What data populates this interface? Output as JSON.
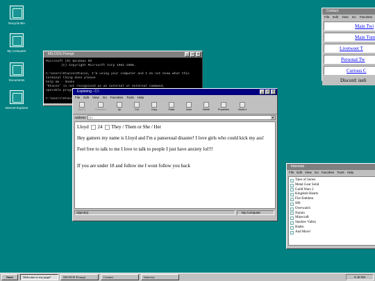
{
  "desktop": {
    "icons": [
      {
        "label": "Recycle Bin"
      },
      {
        "label": "My Computer"
      },
      {
        "label": "Documents"
      },
      {
        "label": "Internet Explorer"
      }
    ]
  },
  "dos_window": {
    "title": "MS-DOS Prompt",
    "lines": [
      "Microsoft (R) Windows 98",
      "        (C) Copyright Microsoft Corp 1981-1998.",
      "",
      "C:\\Users\\Otacon>Otacon, I'm using your computer and I do not know what this terminal thing does please",
      "help me - Snake",
      "'Otacon' is not recognized as an internal or external command,",
      "operable program or batch file.",
      "",
      "C:\\Users\\Otacon>"
    ]
  },
  "explorer_window": {
    "title": "Exploring - C:\\",
    "menu": [
      "File",
      "Edit",
      "View",
      "Go",
      "Favorites",
      "Tools",
      "Help"
    ],
    "toolbar": [
      {
        "label": "Back",
        "icon": "back-arrow-icon",
        "dropdown": true
      },
      {
        "label": "Forward",
        "icon": "forward-arrow-icon",
        "dropdown": true
      },
      {
        "label": "Up",
        "icon": "up-folder-icon"
      },
      {
        "label": "Cut",
        "icon": "scissors-icon"
      },
      {
        "label": "Copy",
        "icon": "copy-icon"
      },
      {
        "label": "Paste",
        "icon": "paste-icon"
      },
      {
        "label": "Undo",
        "icon": "undo-icon"
      },
      {
        "label": "Delete",
        "icon": "delete-icon"
      },
      {
        "label": "Properties",
        "icon": "properties-icon"
      },
      {
        "label": "Views",
        "icon": "views-icon",
        "dropdown": true
      }
    ],
    "address_label": "Address",
    "address_value": "C:\\",
    "content": {
      "name": "Lloyd",
      "age": "24",
      "pronouns": "They / Them or She / Her",
      "paragraphs": [
        "Hey gamers my name is Lloyd and I'm a pansexual disaster! I love girls who could kick my ass!",
        "Feel free to talk to me I love to talk to people I just have anxiety lol!!!",
        "If you are under 18 and follow me I wont follow you back"
      ]
    },
    "status_left": "object(s)",
    "status_right": "My Computer"
  },
  "contact_window": {
    "title": "Contact",
    "menu": [
      "File",
      "Edit",
      "View",
      "Go",
      "Favorites"
    ],
    "links": [
      "Main Twi",
      "Main Tum",
      "Livetweet T",
      "Personal Tw",
      "Curious C"
    ],
    "discord": "Discord: iseli"
  },
  "interests_window": {
    "title": "Interests",
    "menu": [
      "File",
      "Edit",
      "View",
      "Go",
      "Favorites",
      "Tools",
      "Help"
    ],
    "items": [
      "Tales of Series",
      "Metal Gear Solid",
      "Guild Wars 2",
      "Kingdom Hearts",
      "Fire Emblem",
      "999",
      "Overwatch",
      "Naruto",
      "Minecraft",
      "Stardew Valley",
      "Hades",
      "And More!"
    ]
  },
  "taskbar": {
    "start": "Start",
    "items": [
      "Welcome to my page!",
      "MS-DOS Prompt",
      "Contact",
      "Interests"
    ],
    "clock": "9:38 PM"
  }
}
